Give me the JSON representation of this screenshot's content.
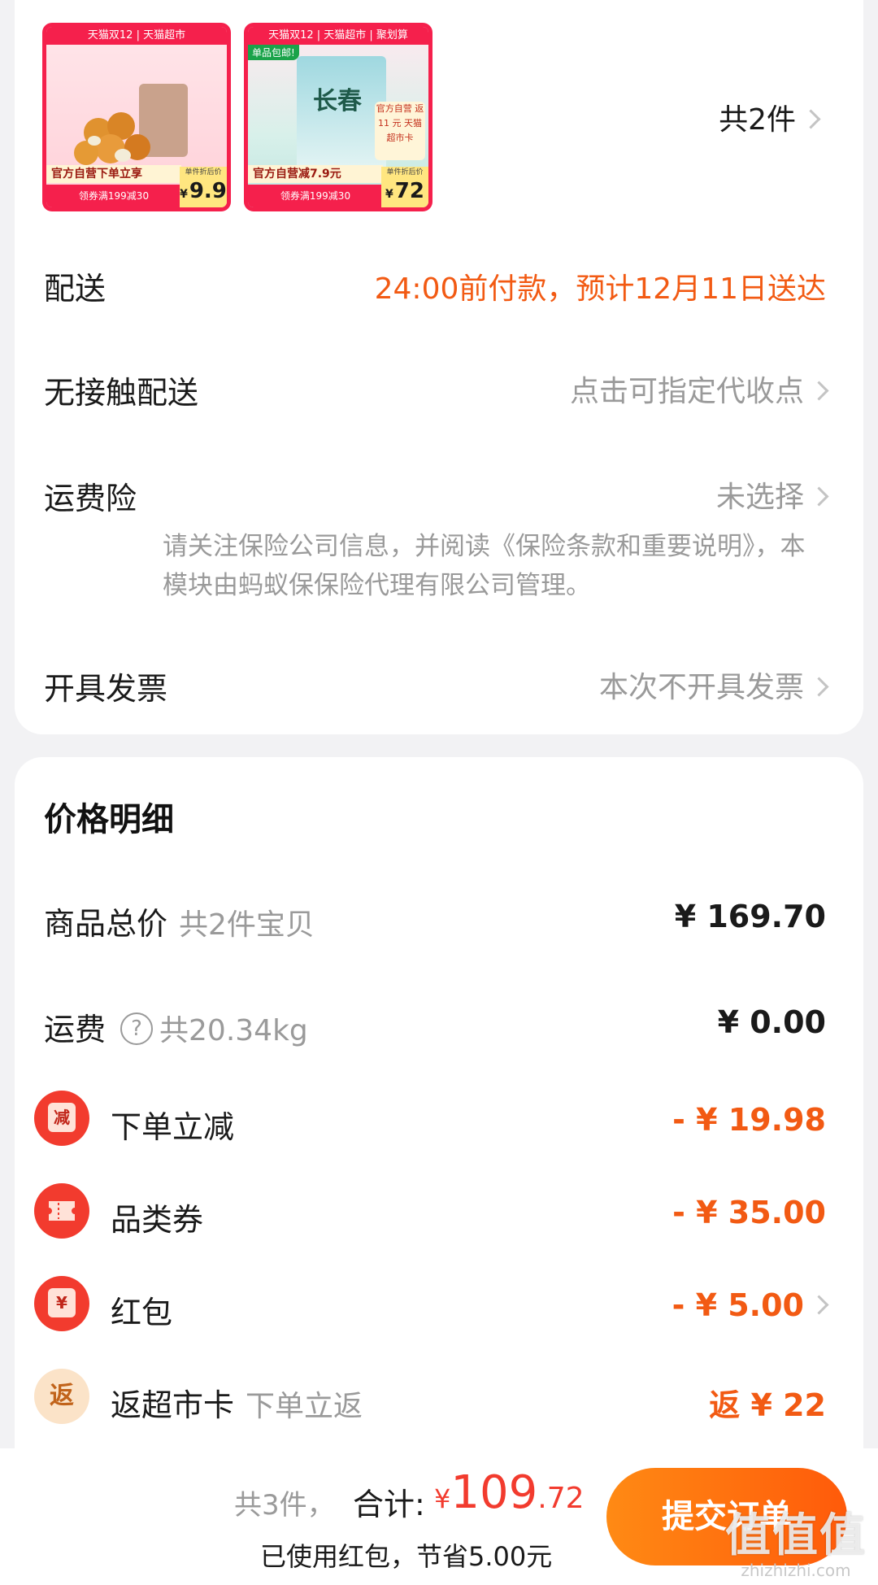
{
  "products": {
    "count_label": "共2件",
    "items": [
      {
        "banner": "天猫双12 | 天猫超市",
        "promo": "官方自营下单立享",
        "coupon": "领券满199减30",
        "price_label": "单件折后价",
        "price": "9.9",
        "yen": "¥"
      },
      {
        "banner": "天猫双12 | 天猫超市 | 聚划算",
        "solo_tag": "单品包邮!",
        "pkg_text": "长春",
        "side_promo": "官方自营 返 11 元 天猫超市卡",
        "promo": "官方自营减7.9元",
        "coupon": "领券满199减30",
        "price_label": "单件折后价",
        "price": "72",
        "yen": "¥"
      }
    ]
  },
  "delivery": {
    "label": "配送",
    "value": "24:00前付款，预计12月11日送达"
  },
  "contactless": {
    "label": "无接触配送",
    "value": "点击可指定代收点"
  },
  "shipping_insurance": {
    "label": "运费险",
    "value": "未选择",
    "note": "请关注保险公司信息，并阅读《保险条款和重要说明》，本模块由蚂蚁保保险代理有限公司管理。"
  },
  "invoice": {
    "label": "开具发票",
    "value": "本次不开具发票"
  },
  "price_detail": {
    "title": "价格明细",
    "subtotal": {
      "label": "商品总价",
      "sub": "共2件宝贝",
      "amount": "¥ 169.70"
    },
    "freight": {
      "label": "运费",
      "help": "?",
      "sub": "共20.34kg",
      "amount": "¥ 0.00"
    },
    "order_discount": {
      "icon": "减",
      "label": "下单立减",
      "amount": "- ¥ 19.98"
    },
    "category_coupon": {
      "label": "品类券",
      "amount": "- ¥ 35.00"
    },
    "red_packet": {
      "icon": "¥",
      "label": "红包",
      "amount": "- ¥ 5.00"
    },
    "cashback_card": {
      "icon": "返",
      "label": "返超市卡",
      "sub": "下单立返",
      "amount": "返 ¥ 22"
    }
  },
  "footer": {
    "count": "共3件，",
    "total_label": "合计:",
    "yen": "¥",
    "total_int": "109",
    "total_dec": ".72",
    "saved": "已使用红包，节省5.00元",
    "submit": "提交订单",
    "watermark_big": "值值值",
    "watermark_small": "zhizhizhi.com"
  },
  "colors": {
    "accent_orange": "#f25a13",
    "price_red": "#f23b2e",
    "button_start": "#ff8a14",
    "button_end": "#ff5a0a",
    "thumb_border": "#f5204c"
  }
}
